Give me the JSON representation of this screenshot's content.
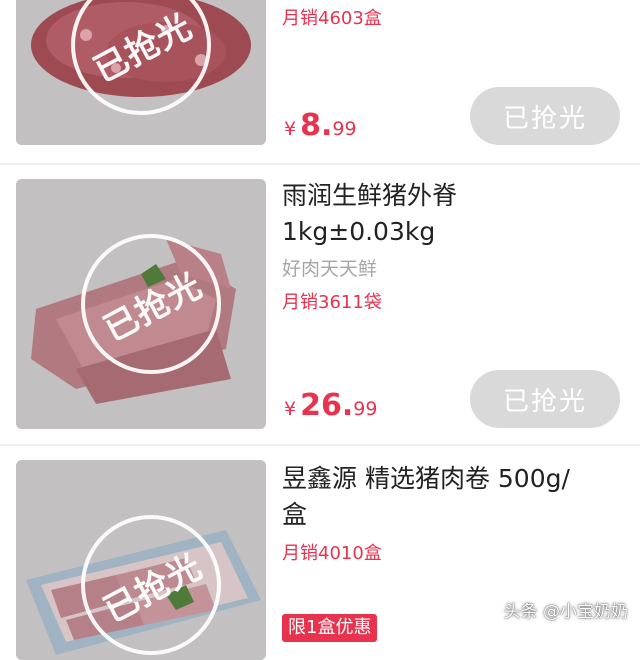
{
  "products": [
    {
      "title": "",
      "subtitle": "",
      "sales": "月销4603盒",
      "price": {
        "currency": "¥",
        "integer": "8.",
        "decimal": "99"
      },
      "button": "已抢光",
      "stamp": "已抢光",
      "image_icon": "minced-pork-image"
    },
    {
      "title_line1": "雨润生鲜猪外脊",
      "title_line2": "1kg±0.03kg",
      "subtitle": "好肉天天鲜",
      "sales": "月销3611袋",
      "price": {
        "currency": "¥",
        "integer": "26.",
        "decimal": "99"
      },
      "button": "已抢光",
      "stamp": "已抢光",
      "image_icon": "pork-loin-image"
    },
    {
      "title_line1": "昱鑫源 精选猪肉卷 500g/",
      "title_line2": "盒",
      "sales": "月销4010盒",
      "badge": "限1盒优惠",
      "stamp": "已抢光",
      "image_icon": "pork-roll-image"
    }
  ],
  "watermark": "头条 @小宝奶奶",
  "colors": {
    "accent": "#e8334f",
    "button_disabled": "#d9d9d9",
    "thumb_overlay": "#bdbdbd"
  }
}
